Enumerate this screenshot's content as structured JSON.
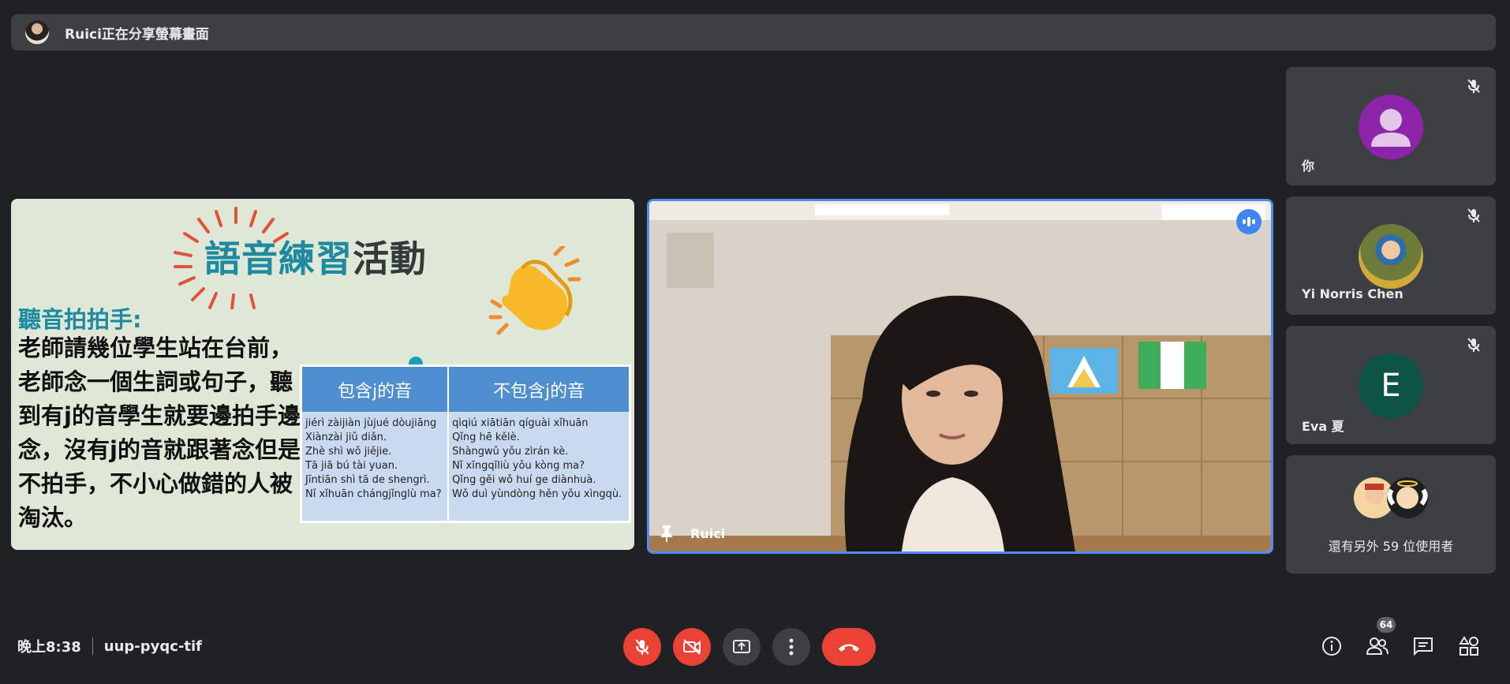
{
  "share_bar": {
    "text": "Ruici正在分享螢幕畫面"
  },
  "slide": {
    "title_part1": "語音練習",
    "title_part2": "活動",
    "subtitle": "聽音拍拍手:",
    "body": "老師請幾位學生站在台前，老師念一個生詞或句子，聽到有j的音學生就要邊拍手邊念，沒有j的音就跟著念但是不拍手，不小心做錯的人被淘汰。",
    "table": {
      "headers": [
        "包含j的音",
        "不包含j的音"
      ],
      "col1": [
        "jiérì zàijiàn jùjué dòujiāng",
        "Xiànzài jiǔ diǎn.",
        "Zhè shì wǒ jiějie.",
        "Tā jiā bú tài yuan.",
        "Jīntiān shì tā de shengrì.",
        "Nǐ xǐhuān chángjǐnglù ma?"
      ],
      "col2": [
        "qìqiú xiātiān qíguài xǐhuān",
        "Qǐng hē kělè.",
        "Shàngwǔ yǒu zìrán kè.",
        "Nǐ xīngqīliù yǒu kòng ma?",
        "Qǐng gěi wǒ huí ge diànhuà.",
        "Wǒ duì yùndòng hěn yǒu xìngqù."
      ]
    }
  },
  "speaker": {
    "name": "Ruici"
  },
  "participants": [
    {
      "name": "你",
      "avatar_color": "#8e24aa"
    },
    {
      "name": "Yi Norris Chen"
    },
    {
      "name": "Eva 夏",
      "initial": "E",
      "avatar_color": "#0b5345"
    }
  ],
  "more": {
    "text": "還有另外 59 位使用者"
  },
  "bottom": {
    "time": "晚上8:38",
    "meeting_code": "uup-pyqc-tif",
    "participant_count": "64"
  },
  "icons": [
    "mic-off-icon",
    "camera-off-icon",
    "present-icon",
    "more-vert-icon",
    "hangup-icon",
    "info-icon",
    "people-icon",
    "chat-icon",
    "activities-icon",
    "pin-icon"
  ],
  "colors": {
    "accent": "#4f8cf5",
    "danger": "#ea4335",
    "bg": "#202124",
    "tile": "#3c4043"
  }
}
